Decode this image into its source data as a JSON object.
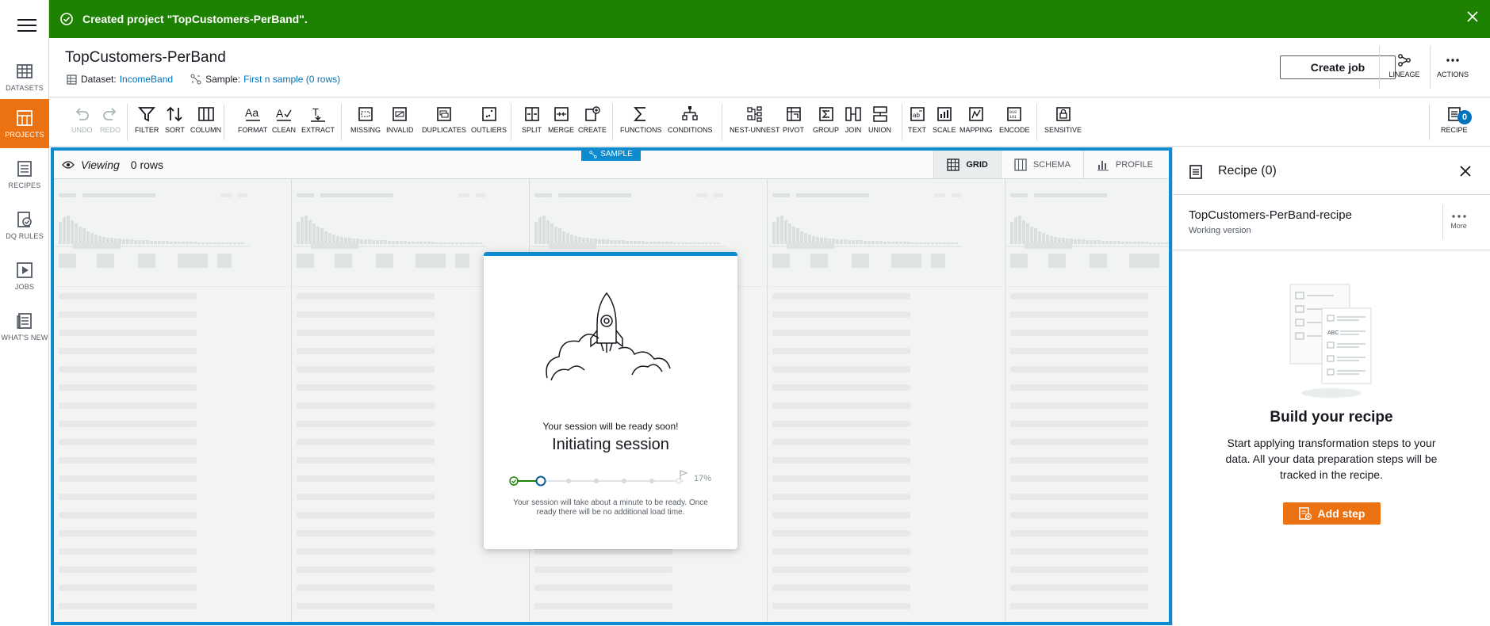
{
  "banner": {
    "message": "Created project \"TopCustomers-PerBand\"."
  },
  "nav": {
    "items": [
      {
        "label": "DATASETS",
        "icon": "datasets-icon"
      },
      {
        "label": "PROJECTS",
        "icon": "projects-icon"
      },
      {
        "label": "RECIPES",
        "icon": "recipes-icon"
      },
      {
        "label": "DQ RULES",
        "icon": "dq-rules-icon"
      },
      {
        "label": "JOBS",
        "icon": "jobs-icon"
      },
      {
        "label": "WHAT'S NEW",
        "icon": "whats-new-icon"
      }
    ]
  },
  "header": {
    "title": "TopCustomers-PerBand",
    "dataset_label": "Dataset:",
    "dataset_value": "IncomeBand",
    "sample_label": "Sample:",
    "sample_value": "First n sample (0 rows)",
    "create_job": "Create job",
    "lineage": "LINEAGE",
    "actions": "ACTIONS"
  },
  "toolbar": {
    "undo": "UNDO",
    "redo": "REDO",
    "filter": "FILTER",
    "sort": "SORT",
    "column": "COLUMN",
    "format": "FORMAT",
    "clean": "CLEAN",
    "extract": "EXTRACT",
    "missing": "MISSING",
    "invalid": "INVALID",
    "duplicates": "DUPLICATES",
    "outliers": "OUTLIERS",
    "split": "SPLIT",
    "merge": "MERGE",
    "create": "CREATE",
    "functions": "FUNCTIONS",
    "conditions": "CONDITIONS",
    "nest_unnest": "NEST-UNNEST",
    "pivot": "PIVOT",
    "group": "GROUP",
    "join": "JOIN",
    "union": "UNION",
    "text": "TEXT",
    "scale": "SCALE",
    "mapping": "MAPPING",
    "encode": "ENCODE",
    "sensitive": "SENSITIVE",
    "recipe": "RECIPE",
    "recipe_count": "0"
  },
  "grid": {
    "sample_tag": "SAMPLE",
    "viewing_label": "Viewing",
    "rows": "0 rows",
    "tabs": {
      "grid": "GRID",
      "schema": "SCHEMA",
      "profile": "PROFILE"
    }
  },
  "session": {
    "subtitle": "Your session will be ready soon!",
    "title": "Initiating session",
    "progress_percent": "17%",
    "progress_fraction": 0.17,
    "note": "Your session will take about a minute to be ready. Once ready there will be no additional load time."
  },
  "recipe_panel": {
    "title": "Recipe (0)",
    "recipe_name": "TopCustomers-PerBand-recipe",
    "version": "Working version",
    "more": "More",
    "build_title": "Build your recipe",
    "build_desc": "Start applying transformation steps to your data. All your data preparation steps will be tracked in the recipe.",
    "add_step": "Add step"
  },
  "colors": {
    "accent": "#ec7211",
    "banner": "#1d8102",
    "link": "#0073bb",
    "frame": "#0d8bcf"
  }
}
